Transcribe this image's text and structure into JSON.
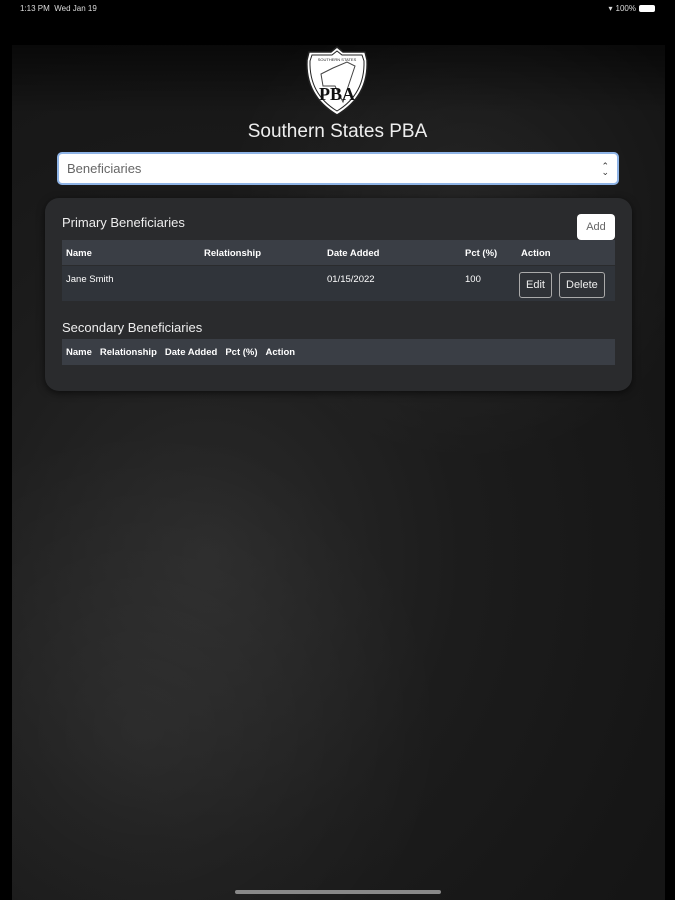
{
  "status": {
    "time": "1:13 PM",
    "date": "Wed Jan 19",
    "battery": "100%"
  },
  "app": {
    "title": "Southern States PBA",
    "logo_text_top": "SOUTHERN STATES",
    "logo_text": "PBA"
  },
  "select": {
    "value": "Beneficiaries"
  },
  "primary": {
    "title": "Primary Beneficiaries",
    "add_label": "Add",
    "headers": [
      "Name",
      "Relationship",
      "Date Added",
      "Pct (%)",
      "Action"
    ],
    "rows": [
      {
        "name": "Jane Smith",
        "relationship": "",
        "date": "01/15/2022",
        "pct": "100",
        "edit": "Edit",
        "delete": "Delete"
      }
    ]
  },
  "secondary": {
    "title": "Secondary Beneficiaries",
    "headers": [
      "Name",
      "Relationship",
      "Date Added",
      "Pct (%)",
      "Action"
    ]
  }
}
